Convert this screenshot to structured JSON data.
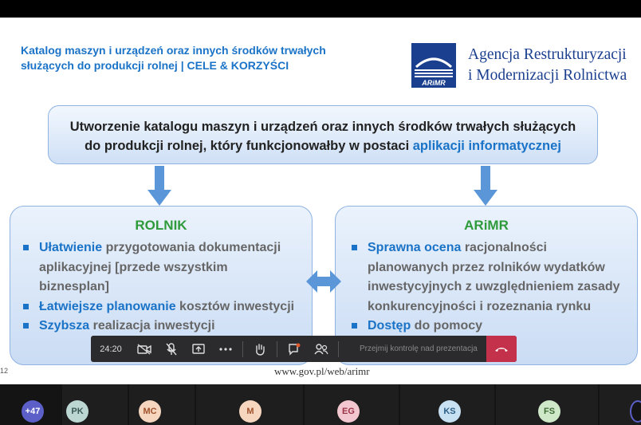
{
  "slide": {
    "title_line1": "Katalog maszyn i urządzeń oraz innych środków trwałych",
    "title_line2": "służących do produkcji rolnej | CELE & KORZYŚCI",
    "logo_text": "ARiMR",
    "agency_line1": "Agencja Restrukturyzacji",
    "agency_line2": "i Modernizacji Rolnictwa",
    "main_line1": "Utworzenie katalogu maszyn i urządzeń oraz innych środków trwałych służących",
    "main_line2_prefix": "do produkcji rolnej, który funkcjonowałby w postaci",
    "main_line2_highlight": "aplikacji informatycznej",
    "left": {
      "heading": "ROLNIK",
      "items": [
        {
          "lead": "Ułatwienie",
          "rest": " przygotowania dokumentacji aplikacyjnej [przede wszystkim biznesplan]"
        },
        {
          "lead": "Łatwiejsze planowanie",
          "rest": " kosztów inwestycji"
        },
        {
          "lead": "Szybsza",
          "rest": " realizacja inwestycji"
        }
      ]
    },
    "right": {
      "heading": "ARiMR",
      "items": [
        {
          "lead": "Sprawna ocena",
          "rest": " racjonalności planowanych przez rolników wydatków inwestycyjnych z uwzględnieniem zasady konkurencyjności i rozeznania rynku"
        },
        {
          "lead": "Dostęp",
          "rest": " do pomocy"
        }
      ]
    },
    "footer_url": "www.gov.pl/web/arimr",
    "slide_number": "12"
  },
  "call_bar": {
    "timer": "24:20",
    "take_control": "Przejmij kontrolę nad prezentacja",
    "icons": [
      "camera-off-icon",
      "mic-off-icon",
      "share-icon",
      "more-icon",
      "raise-hand-icon",
      "chat-icon",
      "participants-icon",
      "hangup-icon"
    ]
  },
  "participants": [
    {
      "initials": "+47",
      "bg": "#5b5fc7",
      "fg": "#ffffff"
    },
    {
      "initials": "PK",
      "bg": "#bcd7d2",
      "fg": "#3b5a55"
    },
    {
      "initials": "MC",
      "bg": "#f6d6bf",
      "fg": "#a0522d"
    },
    {
      "initials": "M",
      "bg": "#f6d6bf",
      "fg": "#a0522d"
    },
    {
      "initials": "EG",
      "bg": "#f3c7cf",
      "fg": "#9a3347"
    },
    {
      "initials": "KS",
      "bg": "#c7e0f2",
      "fg": "#2b5e86"
    },
    {
      "initials": "FS",
      "bg": "#cfe8c8",
      "fg": "#3e6b34"
    }
  ],
  "colors": {
    "accent": "#1a73c7",
    "heading_green": "#2e9a3a",
    "hangup": "#c4314b"
  }
}
